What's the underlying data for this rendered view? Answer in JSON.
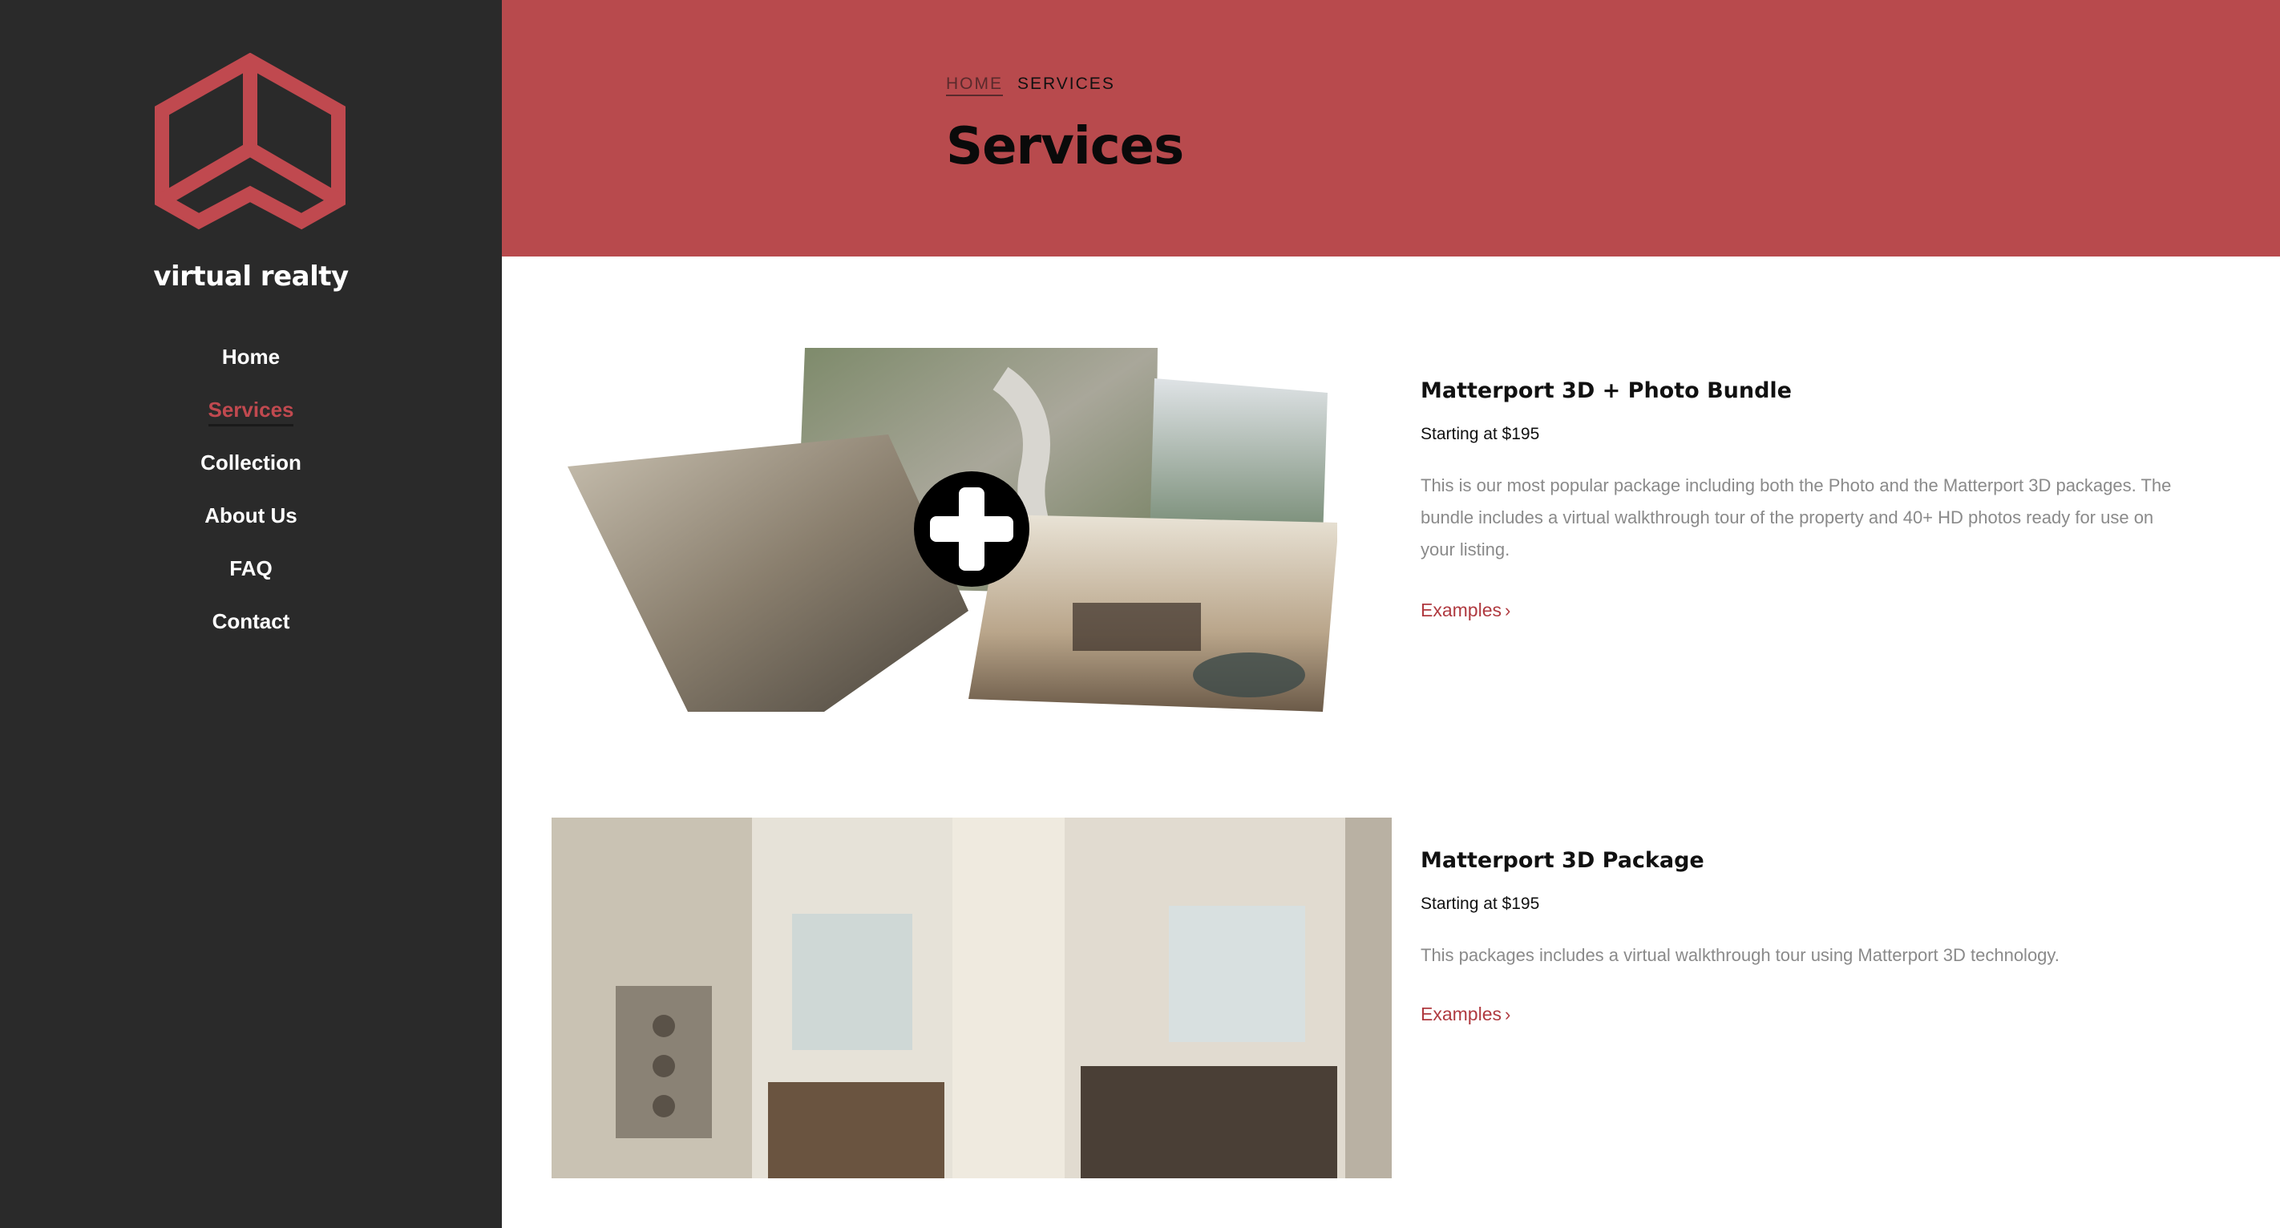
{
  "brand": {
    "name": "virtual realty",
    "logo": "hexagon-cube-logo",
    "accent_color": "#c0494f"
  },
  "nav": {
    "items": [
      {
        "label": "Home"
      },
      {
        "label": "Services",
        "active": true
      },
      {
        "label": "Collection"
      },
      {
        "label": "About Us"
      },
      {
        "label": "FAQ"
      },
      {
        "label": "Contact"
      }
    ]
  },
  "header": {
    "breadcrumb": {
      "home": "HOME",
      "current": "SERVICES"
    },
    "title": "Services",
    "band_color": "#b84a4d"
  },
  "services": [
    {
      "title": "Matterport 3D + Photo Bundle",
      "price": "Starting at $195",
      "description": "This is our most popular package including both the Photo and the Matterport 3D packages. The bundle includes a virtual walkthrough tour of the property and 40+ HD photos ready for use on your listing.",
      "link": "Examples",
      "image": "dollhouse-collage-with-plus-icon"
    },
    {
      "title": "Matterport 3D Package",
      "price": "Starting at $195",
      "description": "This packages includes a virtual walkthrough tour using Matterport 3D technology.",
      "link": "Examples",
      "image": "living-room-interior"
    }
  ]
}
